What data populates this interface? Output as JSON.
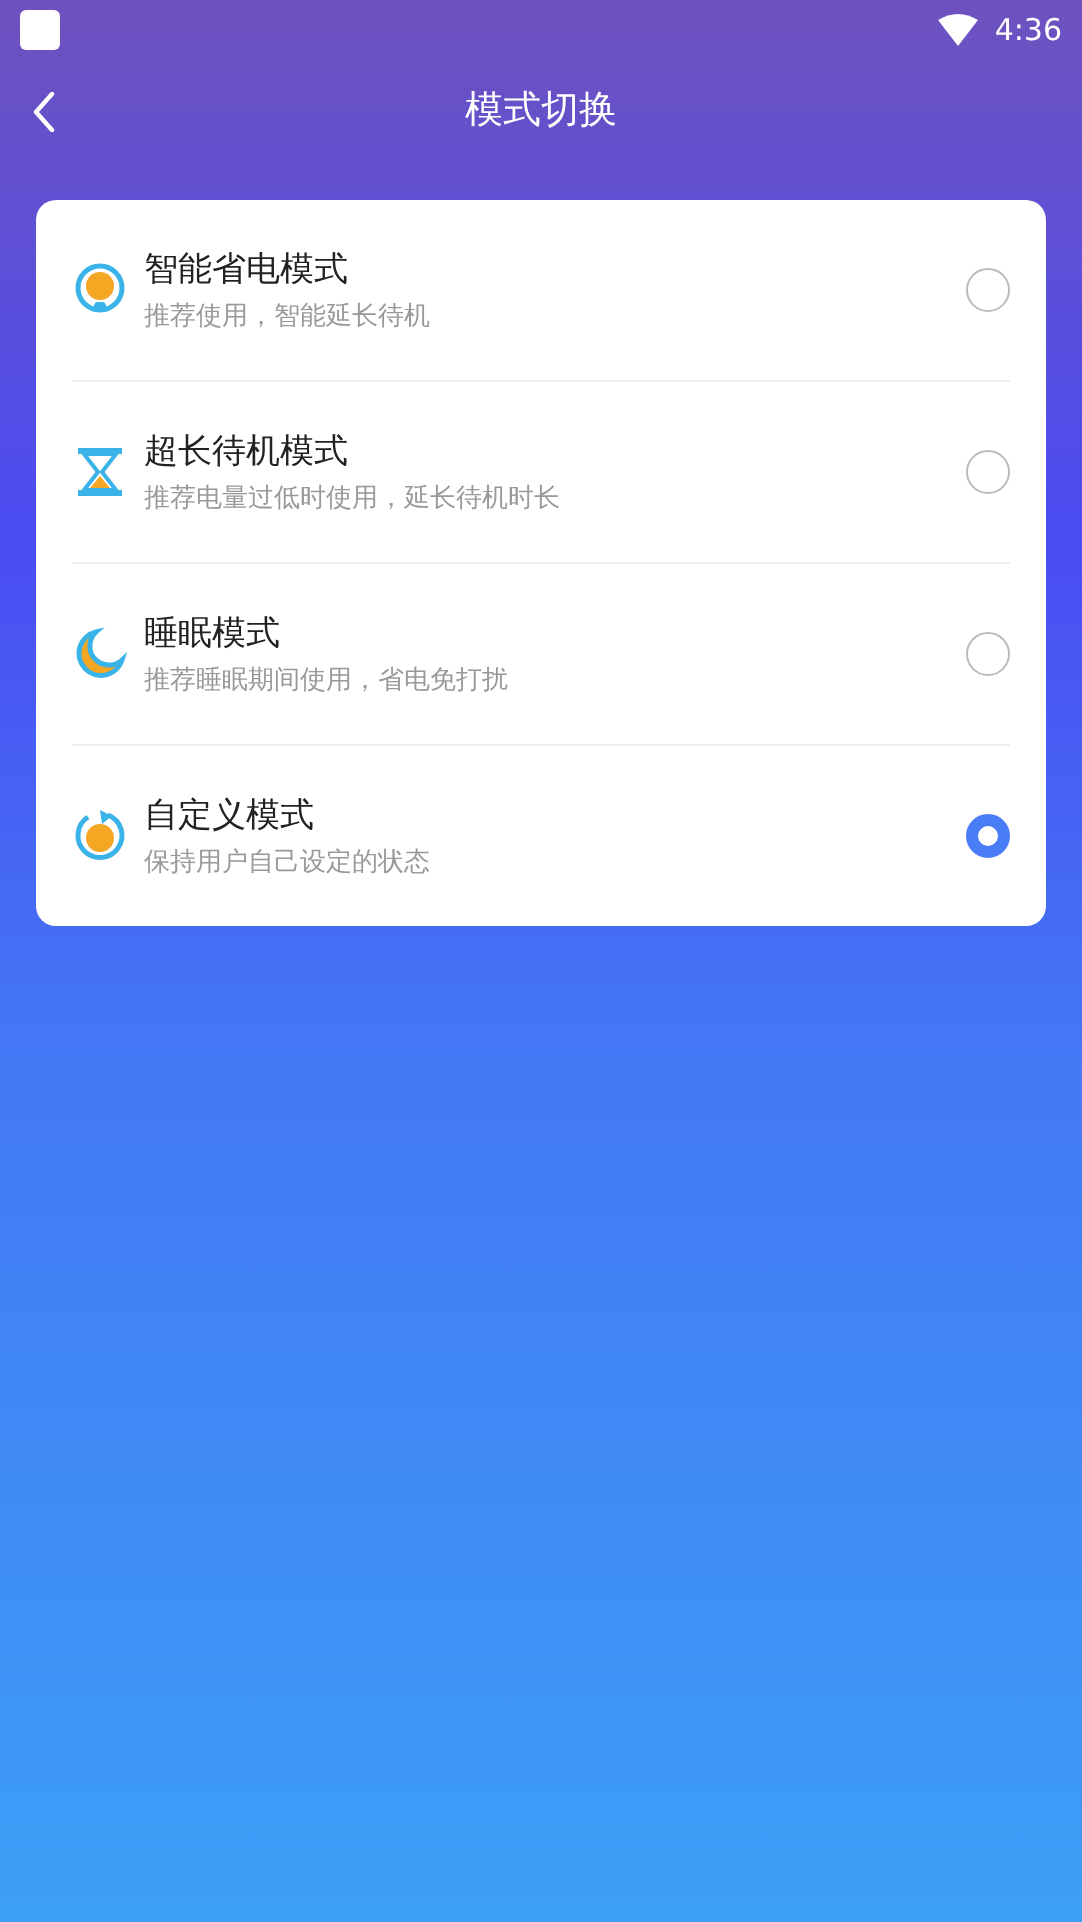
{
  "status_bar": {
    "time": "4:36"
  },
  "header": {
    "title": "模式切换"
  },
  "modes": [
    {
      "title": "智能省电模式",
      "subtitle": "推荐使用，智能延长待机",
      "selected": false
    },
    {
      "title": "超长待机模式",
      "subtitle": "推荐电量过低时使用，延长待机时长",
      "selected": false
    },
    {
      "title": "睡眠模式",
      "subtitle": "推荐睡眠期间使用，省电免打扰",
      "selected": false
    },
    {
      "title": "自定义模式",
      "subtitle": "保持用户自己设定的状态",
      "selected": true
    }
  ]
}
